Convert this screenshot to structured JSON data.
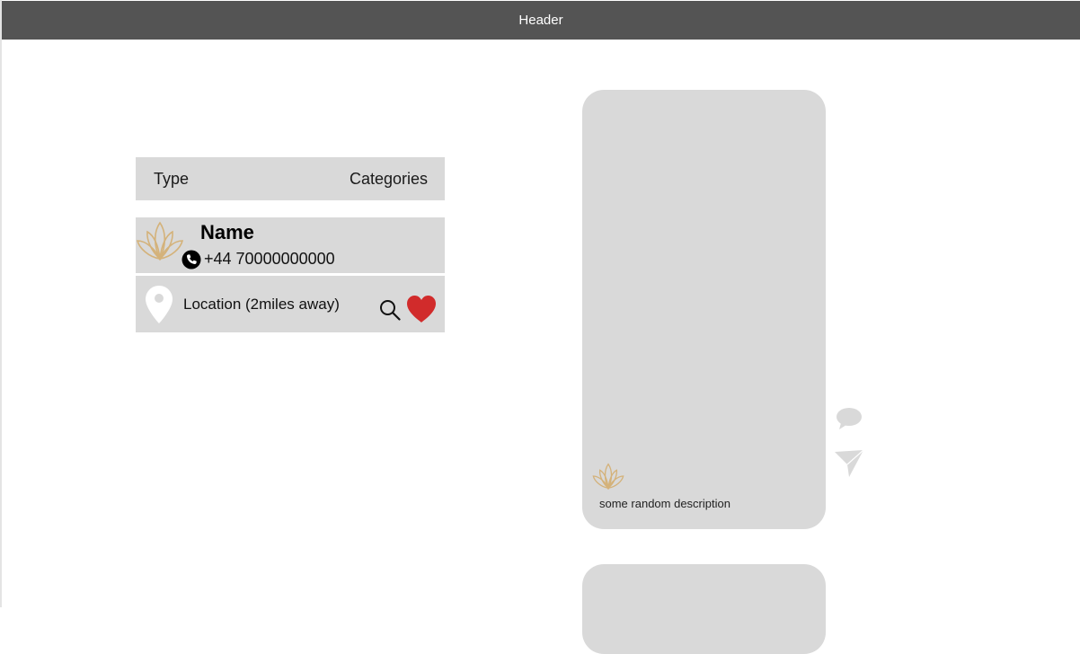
{
  "header": {
    "title": "Header"
  },
  "filters": {
    "type_label": "Type",
    "categories_label": "Categories"
  },
  "listing": {
    "name": "Name",
    "phone": "+44 70000000000",
    "location": "Location (2miles away)",
    "icons": [
      "lotus-logo-icon",
      "phone-icon",
      "location-pin-icon",
      "search-icon",
      "heart-icon"
    ]
  },
  "post": {
    "description": "some random description",
    "icons": [
      "lotus-logo-icon",
      "comment-icon",
      "send-icon"
    ]
  },
  "colors": {
    "header_bg": "#545454",
    "panel_bg": "#d9d9d9",
    "heart": "#d12b2b",
    "logo_gold": "#d4b27a"
  }
}
